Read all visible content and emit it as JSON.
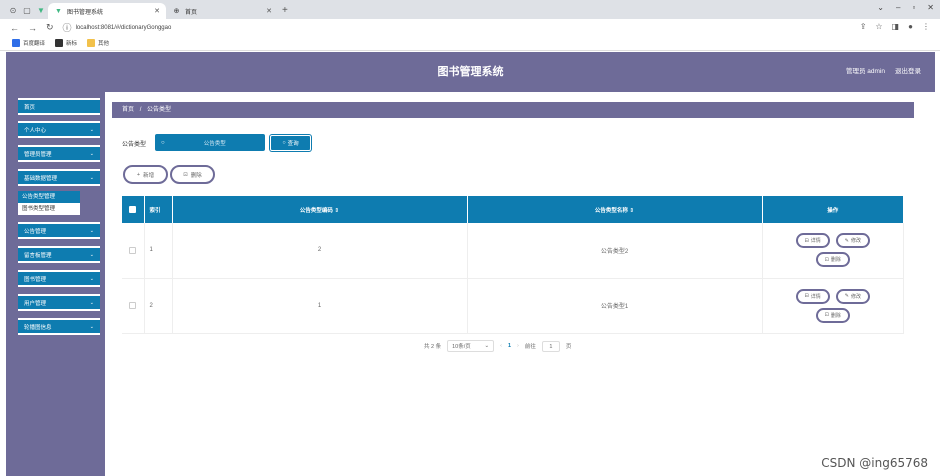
{
  "browser": {
    "tabs": [
      {
        "label": "图书管理系统",
        "active": true
      },
      {
        "label": "首页",
        "active": false
      }
    ],
    "url": "localhost:8081/#/dictionaryGonggao",
    "bookmarks": [
      {
        "label": "百度翻译",
        "color": "#2f6ee8"
      },
      {
        "label": "新标",
        "color": "#333333"
      },
      {
        "label": "其他",
        "color": "#f2c14b"
      }
    ]
  },
  "header": {
    "title": "图书管理系统",
    "user": "管理员 admin",
    "logout": "退出登录"
  },
  "sidebar": {
    "items": [
      {
        "label": "首页"
      },
      {
        "label": "个人中心"
      },
      {
        "label": "管理员管理"
      },
      {
        "label": "基础数据管理"
      },
      {
        "label": "公告管理"
      },
      {
        "label": "留言板管理"
      },
      {
        "label": "图书管理"
      },
      {
        "label": "用户管理"
      },
      {
        "label": "轮播图信息"
      }
    ],
    "submenu": [
      {
        "label": "公告类型管理",
        "active": true
      },
      {
        "label": "图书类型管理",
        "active": false
      }
    ]
  },
  "breadcrumb": {
    "home": "首页",
    "sep": "/",
    "current": "公告类型"
  },
  "filter": {
    "label": "公告类型",
    "placeholder": "公告类型",
    "search_label": "查询"
  },
  "actions": {
    "add_label": "新增",
    "delete_label": "删除"
  },
  "table": {
    "columns": [
      "索引",
      "公告类型编码 ⇕",
      "公告类型名称 ⇕",
      "操作"
    ],
    "rows": [
      {
        "index": "1",
        "code": "2",
        "name": "公告类型2"
      },
      {
        "index": "2",
        "code": "1",
        "name": "公告类型1"
      }
    ],
    "ops": {
      "detail": "详情",
      "edit": "修改",
      "delete": "删除"
    }
  },
  "pagination": {
    "total": "共 2 条",
    "page_size": "10条/页",
    "current_page": "1",
    "goto_label": "前往",
    "goto_value": "1",
    "page_suffix": "页"
  },
  "watermark": "CSDN @ing65768",
  "colors": {
    "accent": "#0e7cb0",
    "theme": "#6e6b98"
  }
}
